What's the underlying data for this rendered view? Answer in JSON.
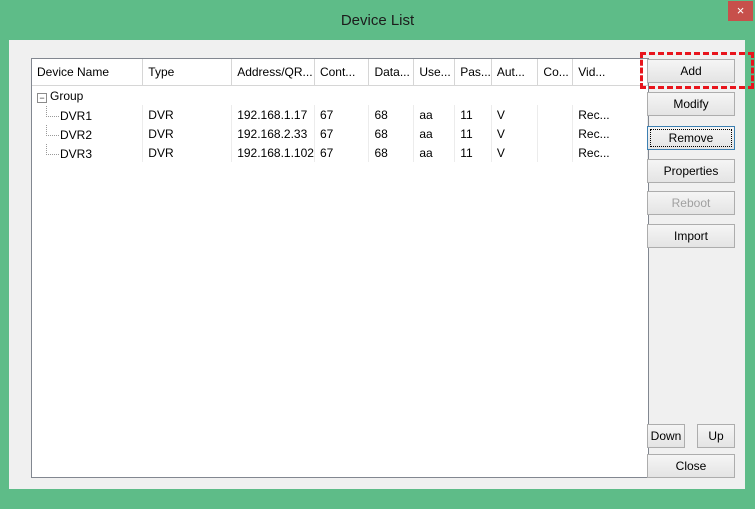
{
  "window": {
    "title": "Device List",
    "close_glyph": "×",
    "accent_color": "#5ebc88"
  },
  "table": {
    "columns": [
      "Device Name",
      "Type",
      "Address/QR...",
      "Cont...",
      "Data...",
      "Use...",
      "Pas...",
      "Aut...",
      "Co...",
      "Vid..."
    ],
    "group": {
      "label": "Group",
      "toggle": "−"
    },
    "rows": [
      [
        "DVR1",
        "DVR",
        "192.168.1.17",
        "67",
        "68",
        "aa",
        "11",
        "V",
        "",
        "Rec..."
      ],
      [
        "DVR2",
        "DVR",
        "192.168.2.33",
        "67",
        "68",
        "aa",
        "11",
        "V",
        "",
        "Rec..."
      ],
      [
        "DVR3",
        "DVR",
        "192.168.1.102",
        "67",
        "68",
        "aa",
        "11",
        "V",
        "",
        "Rec..."
      ]
    ]
  },
  "buttons": {
    "add": "Add",
    "modify": "Modify",
    "remove": "Remove",
    "properties": "Properties",
    "reboot": "Reboot",
    "import": "Import",
    "down": "Down",
    "up": "Up",
    "close": "Close"
  },
  "highlight_color": "#e8141c"
}
